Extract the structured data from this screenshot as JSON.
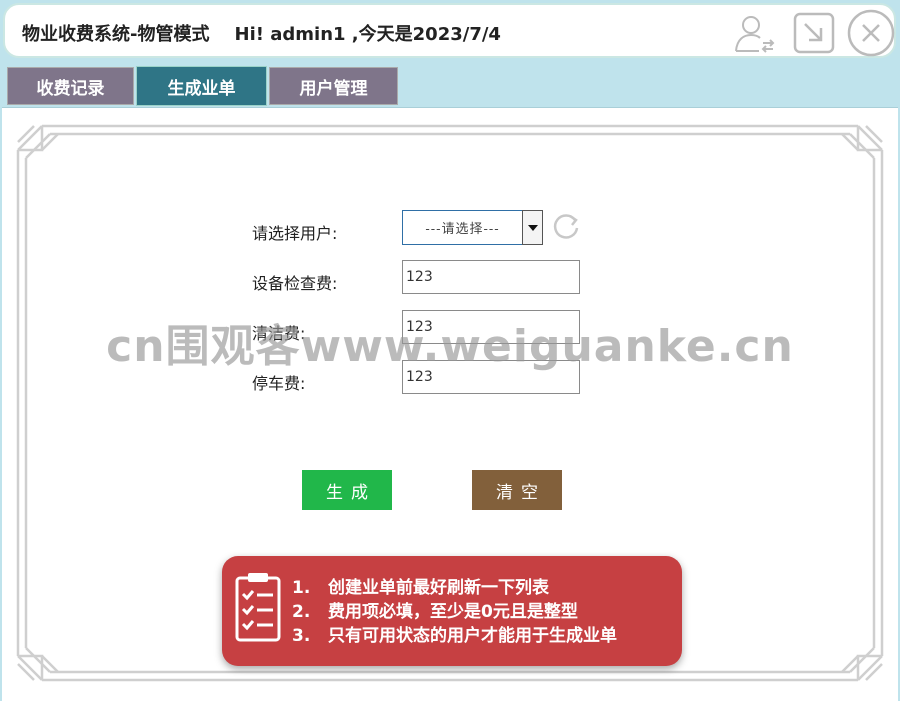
{
  "header": {
    "title": "物业收费系统-物管模式    Hi! admin1 ,今天是2023/7/4",
    "icons": [
      "switch-user-icon",
      "minimize-icon",
      "close-icon"
    ]
  },
  "tabs": [
    {
      "label": "收费记录",
      "active": false
    },
    {
      "label": "生成业单",
      "active": true
    },
    {
      "label": "用户管理",
      "active": false
    }
  ],
  "form": {
    "user_label": "请选择用户:",
    "user_select": "---请选择---",
    "inspection_label": "设备检查费:",
    "inspection_value": "123",
    "cleaning_label": "清洁费:",
    "cleaning_value": "123",
    "parking_label": "停车费:",
    "parking_value": "123"
  },
  "buttons": {
    "generate": "生成",
    "clear": "清空"
  },
  "notice": {
    "lines": [
      "1.   创建业单前最好刷新一下列表",
      "2.   费用项必填，至少是0元且是整型",
      "3.   只有可用状态的用户才能用于生成业单"
    ]
  },
  "watermark": "cn围观客www.weiguanke.cn",
  "colors": {
    "tab_active": "#2f7586",
    "tab_inactive": "#7f758a",
    "generate_button": "#21b74a",
    "clear_button": "#82603b",
    "notice_bg": "#c64042",
    "background": "#bfe3ec"
  }
}
